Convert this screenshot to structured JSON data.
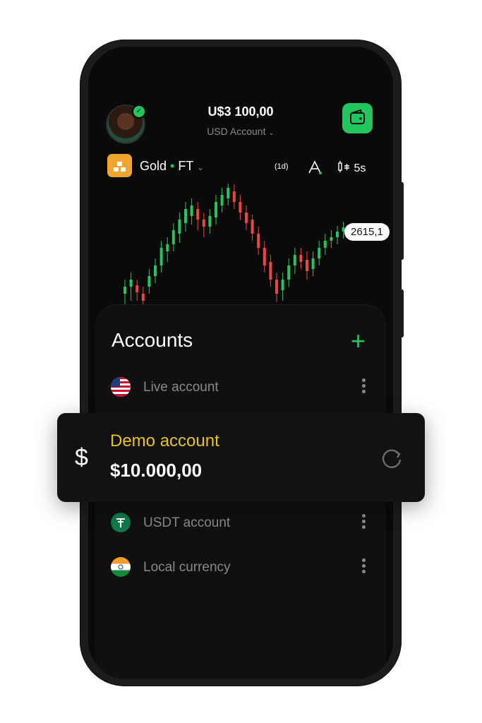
{
  "header": {
    "balance": "U$3 100,00",
    "account_type": "USD Account",
    "online_badge": "✓"
  },
  "asset": {
    "name": "Gold",
    "dot": "•",
    "type": "FT",
    "timeframe": "5s",
    "indicator_label": "(1d)"
  },
  "chart": {
    "current_price": "2615,1"
  },
  "accounts": {
    "title": "Accounts",
    "add_label": "+",
    "items": [
      {
        "label": "Live account",
        "flag": "us-flag"
      },
      {
        "label": "USDT account",
        "flag": "tether-icon"
      },
      {
        "label": "Local currency",
        "flag": "india-flag"
      }
    ]
  },
  "demo": {
    "currency_symbol": "$",
    "name": "Demo account",
    "amount": "$10.000,00"
  },
  "colors": {
    "accent": "#22c55e",
    "demo_name": "#e8c31e",
    "bearish": "#ef4444",
    "bullish": "#22c55e"
  }
}
